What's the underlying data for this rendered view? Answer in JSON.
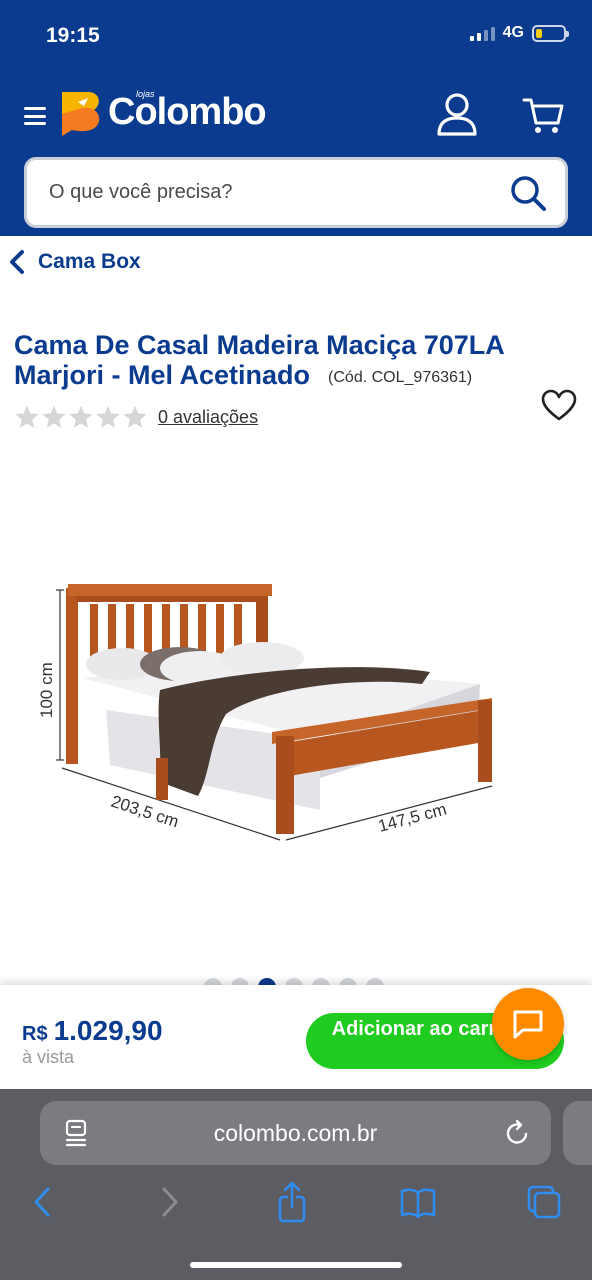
{
  "status_bar": {
    "time": "19:15",
    "network": "4G"
  },
  "header": {
    "logo_small": "lojas",
    "logo_text": "Colombo",
    "search_placeholder": "O que você precisa?"
  },
  "breadcrumb": {
    "back_label": "Cama Box"
  },
  "product": {
    "title": "Cama De Casal Madeira Maciça 707LA Marjori - Mel Acetinado",
    "code": "(Cód. COL_976361)",
    "rating_stars": 0,
    "reviews_label": "0 avaliações",
    "image": {
      "height_label": "100 cm",
      "length_label": "203,5 cm",
      "width_label": "147,5 cm"
    },
    "carousel": {
      "total": 7,
      "active_index": 2
    }
  },
  "buy_bar": {
    "currency": "R$",
    "price": "1.029,90",
    "price_note": "à vista",
    "add_to_cart_label": "Adicionar ao carrinho"
  },
  "browser": {
    "url": "colombo.com.br"
  },
  "colors": {
    "brand_blue": "#0a3b8f",
    "cart_green": "#1fcc1f",
    "chat_orange": "#ff8a00",
    "logo_yellow": "#f7b500",
    "logo_orange": "#f47b20",
    "wood": "#b8561f"
  }
}
